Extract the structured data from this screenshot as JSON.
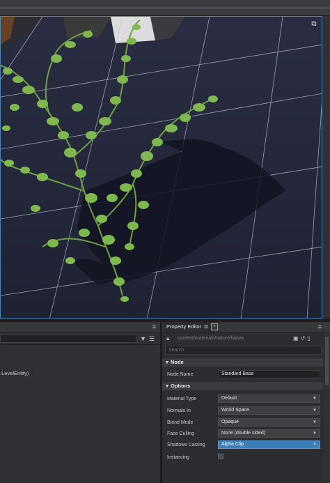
{
  "viewport": {
    "maximize_icon": "maximize-icon"
  },
  "left_panel": {
    "entity_text": ".LevelEntity)",
    "filter_icon": "filter-icon",
    "sort_icon": "sort-icon"
  },
  "property_editor": {
    "tab_label": "Property Editor",
    "tab_close": "⊠",
    "add_tab": "+",
    "path": "content/materials/nature/lianas",
    "search_placeholder": "Search",
    "sections": {
      "node": "Node",
      "options": "Options"
    },
    "node_name_label": "Node Name",
    "node_name_value": "Standard Base",
    "rows": [
      {
        "label": "Material Type",
        "value": "Default"
      },
      {
        "label": "Normals In",
        "value": "World Space"
      },
      {
        "label": "Blend Mode",
        "value": "Opaque"
      },
      {
        "label": "Face Culling",
        "value": "None (double sided)"
      },
      {
        "label": "Shadows Casting",
        "value": "Alpha Clip"
      }
    ],
    "instancing_label": "Instancing",
    "colors": {
      "accent": "#3c7fb8",
      "viewport_border": "#4a86b8",
      "floor": "#23263a",
      "foliage": "#7fb84f"
    }
  }
}
